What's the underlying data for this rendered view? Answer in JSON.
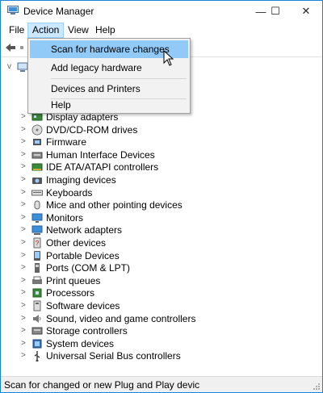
{
  "window": {
    "title": "Device Manager",
    "accent": "#1883d7",
    "controls": {
      "minimize": "—",
      "maximize": "☐",
      "close": "✕"
    }
  },
  "menubar": {
    "items": [
      "File",
      "Action",
      "View",
      "Help"
    ],
    "active": "Action"
  },
  "action_menu": {
    "items": [
      {
        "label": "Scan for hardware changes",
        "highlighted": true
      },
      {
        "label": "Add legacy hardware"
      },
      {
        "label": "Devices and Printers"
      },
      {
        "label": "Help"
      }
    ],
    "highlight_color": "#91c9f7"
  },
  "tree": {
    "items": [
      {
        "label": "Display adapters",
        "icon": "display-adapter-icon"
      },
      {
        "label": "DVD/CD-ROM drives",
        "icon": "dvd-drive-icon"
      },
      {
        "label": "Firmware",
        "icon": "firmware-icon"
      },
      {
        "label": "Human Interface Devices",
        "icon": "hid-icon"
      },
      {
        "label": "IDE ATA/ATAPI controllers",
        "icon": "ide-controller-icon"
      },
      {
        "label": "Imaging devices",
        "icon": "imaging-device-icon"
      },
      {
        "label": "Keyboards",
        "icon": "keyboard-icon"
      },
      {
        "label": "Mice and other pointing devices",
        "icon": "mouse-icon"
      },
      {
        "label": "Monitors",
        "icon": "monitor-icon"
      },
      {
        "label": "Network adapters",
        "icon": "network-adapter-icon"
      },
      {
        "label": "Other devices",
        "icon": "other-devices-icon"
      },
      {
        "label": "Portable Devices",
        "icon": "portable-device-icon"
      },
      {
        "label": "Ports (COM & LPT)",
        "icon": "ports-icon"
      },
      {
        "label": "Print queues",
        "icon": "print-queue-icon"
      },
      {
        "label": "Processors",
        "icon": "processor-icon"
      },
      {
        "label": "Software devices",
        "icon": "software-device-icon"
      },
      {
        "label": "Sound, video and game controllers",
        "icon": "sound-icon"
      },
      {
        "label": "Storage controllers",
        "icon": "storage-controller-icon"
      },
      {
        "label": "System devices",
        "icon": "system-device-icon"
      },
      {
        "label": "Universal Serial Bus controllers",
        "icon": "usb-icon"
      }
    ]
  },
  "statusbar": {
    "text": "Scan for changed or new Plug and Play devic"
  }
}
